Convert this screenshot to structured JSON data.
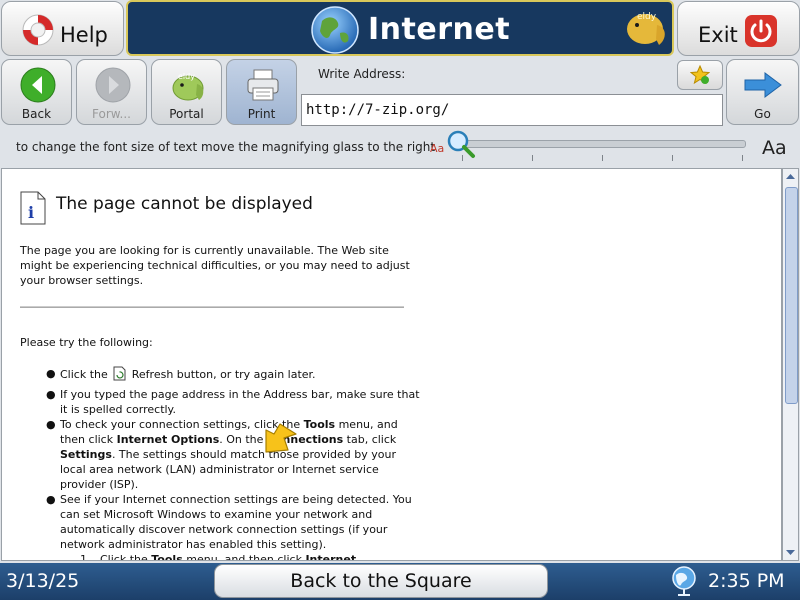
{
  "header": {
    "help_label": "Help",
    "title": "Internet",
    "exit_label": "Exit",
    "brand_logo": "eldy"
  },
  "toolbar": {
    "back_label": "Back",
    "forward_label": "Forw...",
    "portal_label": "Portal",
    "print_label": "Print",
    "address_label": "Write Address:",
    "address_value": "http://7-zip.org/",
    "go_label": "Go"
  },
  "font_size": {
    "hint": "to change the font size of text move the magnifying glass to the right",
    "small_label": "Aa",
    "large_label": "Aa",
    "level": 0
  },
  "page": {
    "title": "The page cannot be displayed",
    "description": "The page you are looking for is currently unavailable. The Web site might be experiencing technical difficulties, or you may need to adjust your browser settings.",
    "try_label": "Please try the following:",
    "tips": {
      "t1a": "Click the",
      "t1b": "Refresh button, or try again later.",
      "t2": "If you typed the page address in the Address bar, make sure that it is spelled correctly.",
      "t3a": "To check your connection settings, click the",
      "t3b": "Tools",
      "t3c": "menu, and then click",
      "t3d": "Internet Options",
      "t3e": ". On the",
      "t3f": "Connections",
      "t3g": "tab, click",
      "t3h": "Settings",
      "t3i": ". The settings should match those provided by your local area network (LAN) administrator or Internet service provider (ISP).",
      "t4": "See if your Internet connection settings are being detected. You can set Microsoft Windows to examine your network and automatically discover network connection settings (if your network administrator has enabled this setting).",
      "t5num": "1.",
      "t5a": "Click the",
      "t5b": "Tools",
      "t5c": "menu, and then click",
      "t5d": "Internet"
    }
  },
  "bottom": {
    "date": "3/13/25",
    "square_label": "Back to the Square",
    "time": "2:35 PM"
  },
  "icons": {
    "help": "lifebuoy-icon",
    "globe": "globe-icon",
    "exit": "power-icon",
    "back": "back-arrow-icon",
    "forward": "forward-arrow-icon",
    "portal": "eldy-icon",
    "print": "printer-icon",
    "favorites": "star-icon",
    "go": "go-arrow-icon",
    "magnifier": "magnifier-icon",
    "info": "info-icon",
    "network": "network-icon"
  },
  "colors": {
    "title_bar": "#17385f",
    "bottom_bar": "#2e5d90",
    "exit_red": "#d9342b",
    "back_green": "#3fae2a",
    "go_blue": "#3b8fd9"
  }
}
